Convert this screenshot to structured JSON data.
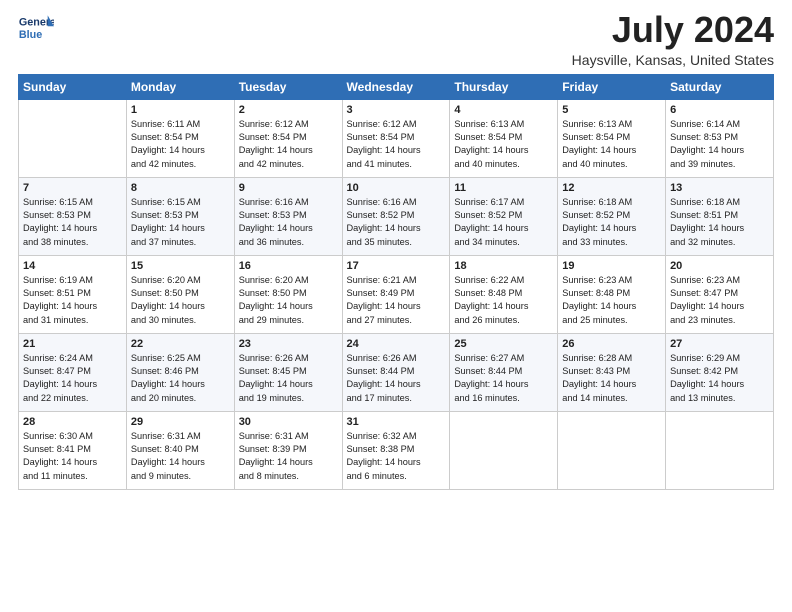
{
  "header": {
    "logo_line1": "General",
    "logo_line2": "Blue",
    "month_year": "July 2024",
    "location": "Haysville, Kansas, United States"
  },
  "weekdays": [
    "Sunday",
    "Monday",
    "Tuesday",
    "Wednesday",
    "Thursday",
    "Friday",
    "Saturday"
  ],
  "weeks": [
    [
      {
        "day": "",
        "info": ""
      },
      {
        "day": "1",
        "info": "Sunrise: 6:11 AM\nSunset: 8:54 PM\nDaylight: 14 hours\nand 42 minutes."
      },
      {
        "day": "2",
        "info": "Sunrise: 6:12 AM\nSunset: 8:54 PM\nDaylight: 14 hours\nand 42 minutes."
      },
      {
        "day": "3",
        "info": "Sunrise: 6:12 AM\nSunset: 8:54 PM\nDaylight: 14 hours\nand 41 minutes."
      },
      {
        "day": "4",
        "info": "Sunrise: 6:13 AM\nSunset: 8:54 PM\nDaylight: 14 hours\nand 40 minutes."
      },
      {
        "day": "5",
        "info": "Sunrise: 6:13 AM\nSunset: 8:54 PM\nDaylight: 14 hours\nand 40 minutes."
      },
      {
        "day": "6",
        "info": "Sunrise: 6:14 AM\nSunset: 8:53 PM\nDaylight: 14 hours\nand 39 minutes."
      }
    ],
    [
      {
        "day": "7",
        "info": "Sunrise: 6:15 AM\nSunset: 8:53 PM\nDaylight: 14 hours\nand 38 minutes."
      },
      {
        "day": "8",
        "info": "Sunrise: 6:15 AM\nSunset: 8:53 PM\nDaylight: 14 hours\nand 37 minutes."
      },
      {
        "day": "9",
        "info": "Sunrise: 6:16 AM\nSunset: 8:53 PM\nDaylight: 14 hours\nand 36 minutes."
      },
      {
        "day": "10",
        "info": "Sunrise: 6:16 AM\nSunset: 8:52 PM\nDaylight: 14 hours\nand 35 minutes."
      },
      {
        "day": "11",
        "info": "Sunrise: 6:17 AM\nSunset: 8:52 PM\nDaylight: 14 hours\nand 34 minutes."
      },
      {
        "day": "12",
        "info": "Sunrise: 6:18 AM\nSunset: 8:52 PM\nDaylight: 14 hours\nand 33 minutes."
      },
      {
        "day": "13",
        "info": "Sunrise: 6:18 AM\nSunset: 8:51 PM\nDaylight: 14 hours\nand 32 minutes."
      }
    ],
    [
      {
        "day": "14",
        "info": "Sunrise: 6:19 AM\nSunset: 8:51 PM\nDaylight: 14 hours\nand 31 minutes."
      },
      {
        "day": "15",
        "info": "Sunrise: 6:20 AM\nSunset: 8:50 PM\nDaylight: 14 hours\nand 30 minutes."
      },
      {
        "day": "16",
        "info": "Sunrise: 6:20 AM\nSunset: 8:50 PM\nDaylight: 14 hours\nand 29 minutes."
      },
      {
        "day": "17",
        "info": "Sunrise: 6:21 AM\nSunset: 8:49 PM\nDaylight: 14 hours\nand 27 minutes."
      },
      {
        "day": "18",
        "info": "Sunrise: 6:22 AM\nSunset: 8:48 PM\nDaylight: 14 hours\nand 26 minutes."
      },
      {
        "day": "19",
        "info": "Sunrise: 6:23 AM\nSunset: 8:48 PM\nDaylight: 14 hours\nand 25 minutes."
      },
      {
        "day": "20",
        "info": "Sunrise: 6:23 AM\nSunset: 8:47 PM\nDaylight: 14 hours\nand 23 minutes."
      }
    ],
    [
      {
        "day": "21",
        "info": "Sunrise: 6:24 AM\nSunset: 8:47 PM\nDaylight: 14 hours\nand 22 minutes."
      },
      {
        "day": "22",
        "info": "Sunrise: 6:25 AM\nSunset: 8:46 PM\nDaylight: 14 hours\nand 20 minutes."
      },
      {
        "day": "23",
        "info": "Sunrise: 6:26 AM\nSunset: 8:45 PM\nDaylight: 14 hours\nand 19 minutes."
      },
      {
        "day": "24",
        "info": "Sunrise: 6:26 AM\nSunset: 8:44 PM\nDaylight: 14 hours\nand 17 minutes."
      },
      {
        "day": "25",
        "info": "Sunrise: 6:27 AM\nSunset: 8:44 PM\nDaylight: 14 hours\nand 16 minutes."
      },
      {
        "day": "26",
        "info": "Sunrise: 6:28 AM\nSunset: 8:43 PM\nDaylight: 14 hours\nand 14 minutes."
      },
      {
        "day": "27",
        "info": "Sunrise: 6:29 AM\nSunset: 8:42 PM\nDaylight: 14 hours\nand 13 minutes."
      }
    ],
    [
      {
        "day": "28",
        "info": "Sunrise: 6:30 AM\nSunset: 8:41 PM\nDaylight: 14 hours\nand 11 minutes."
      },
      {
        "day": "29",
        "info": "Sunrise: 6:31 AM\nSunset: 8:40 PM\nDaylight: 14 hours\nand 9 minutes."
      },
      {
        "day": "30",
        "info": "Sunrise: 6:31 AM\nSunset: 8:39 PM\nDaylight: 14 hours\nand 8 minutes."
      },
      {
        "day": "31",
        "info": "Sunrise: 6:32 AM\nSunset: 8:38 PM\nDaylight: 14 hours\nand 6 minutes."
      },
      {
        "day": "",
        "info": ""
      },
      {
        "day": "",
        "info": ""
      },
      {
        "day": "",
        "info": ""
      }
    ]
  ]
}
